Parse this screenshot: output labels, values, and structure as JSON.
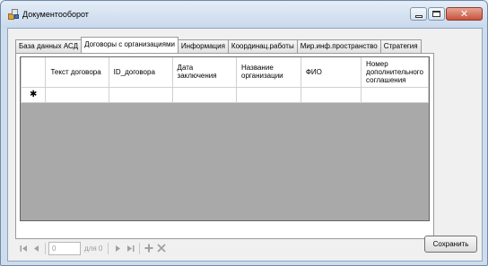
{
  "window": {
    "title": "Документооборот"
  },
  "tabs": [
    {
      "label": "База данных АСД",
      "active": false
    },
    {
      "label": "Договоры с организациями",
      "active": true
    },
    {
      "label": "Информация",
      "active": false
    },
    {
      "label": "Координац.работы",
      "active": false
    },
    {
      "label": "Мир.инф.пространство",
      "active": false
    },
    {
      "label": "Стратегия",
      "active": false
    }
  ],
  "grid": {
    "columns": [
      "Текст договора",
      "ID_договора",
      "Дата заключения",
      "Название организации",
      "ФИО",
      "Номер дополнительного соглашения"
    ],
    "new_row_marker": "✱"
  },
  "navigator": {
    "position": "0",
    "count_label": "для 0",
    "icons": [
      "move-first-icon",
      "move-previous-icon",
      "move-next-icon",
      "move-last-icon",
      "add-new-icon",
      "delete-icon"
    ]
  },
  "buttons": {
    "save_label": "Сохранить"
  }
}
